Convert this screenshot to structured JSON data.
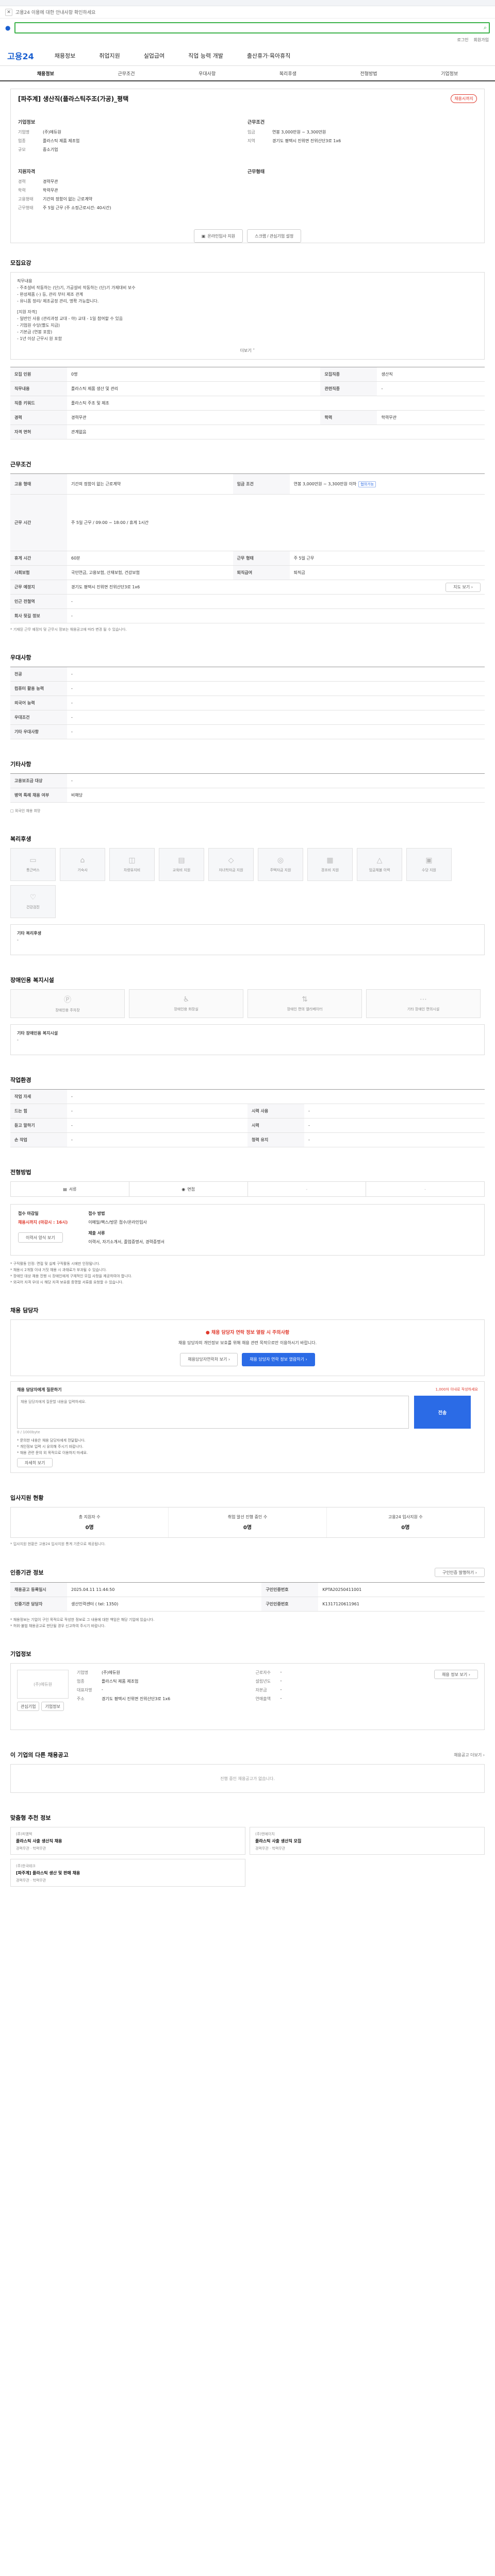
{
  "header": {
    "notice_text": "고용24 이용에 대한 안내사항 확인하세요",
    "util_links": [
      "로그인",
      "회원가입"
    ],
    "brand": "고용24",
    "nav": [
      "채용정보",
      "취업지원",
      "실업급여",
      "직업 능력 개발",
      "출산휴가·육아휴직"
    ]
  },
  "tabs": [
    "채용정보",
    "근무조건",
    "우대사항",
    "복리후생",
    "전형방법",
    "기업정보"
  ],
  "job": {
    "title": "[파주계] 생산직(플라스틱주조(가공)_평택",
    "badge": "채용시까지",
    "company_heading": "기업정보",
    "company_rows": [
      {
        "k": "기업명",
        "v": "(주)에듀원"
      },
      {
        "k": "업종",
        "v": "플라스틱 제품 제조업"
      },
      {
        "k": "규모",
        "v": "중소기업"
      }
    ],
    "condition_heading": "근무조건",
    "condition_rows": [
      {
        "k": "임금",
        "v": "연봉 3,000만원 ~ 3,300만원"
      },
      {
        "k": "지역",
        "v": "경기도 평택시 진위면 진위산단3로 1x6"
      }
    ],
    "req_heading": "지원자격",
    "req_rows": [
      {
        "k": "경력",
        "v": "경력무관"
      },
      {
        "k": "학력",
        "v": "학력무관"
      }
    ],
    "work_heading": "근무형태",
    "work_rows": [
      {
        "k": "고용형태",
        "v": "기간의 정함이 없는 근로계약"
      },
      {
        "k": "근무형태",
        "v": "주 5일 근무 (주 소정근로시간: 40시간)"
      }
    ],
    "apply_button": "온라인입사 지원",
    "scrap_button": "스크랩 / 관심기업 설정"
  },
  "recruit": {
    "heading": "모집요강",
    "desc_lines": [
      "직무내용",
      "- 주조설비 작동하는 (단)기, 가공설비 작동하는 (단)기 가제대비 보수",
      "- 완성제품 (-) 등, 관리 부터 제조 관계",
      "- 유니폼 정리/ 제조공정 관리, 명확 가능합니다.",
      "",
      "[지원 자격]",
      "- 일반인 사용 (관리과정 교대 - 야) 교대 - 1일 참여할 수 있음",
      "- 기업원 수당(별도 지급)",
      "- 기본급 (연봉 포함)",
      "- 1년 이상 근무시 원 포함"
    ],
    "more": "더보기 ˅",
    "rows": [
      {
        "h": "모집 인원",
        "v": "0명",
        "h2": "모집직종",
        "v2": "생산직"
      },
      {
        "h": "직무내용",
        "v": "플라스틱 제품 생산 및 관리",
        "h2": "관련직종",
        "v2": "-"
      },
      {
        "h": "직종 키워드",
        "v": "플라스틱 주조 및 제조",
        "h2": "",
        "v2": ""
      },
      {
        "h": "경력",
        "v": "경력무관",
        "h2": "학력",
        "v2": "학력무관"
      },
      {
        "h": "자격 면허",
        "v": "관계없음",
        "h2": "",
        "v2": ""
      }
    ]
  },
  "conditions": {
    "heading": "근무조건",
    "rows": [
      {
        "h": "고용 형태",
        "v": "기간의 정함이 없는 근로계약",
        "h2": "임금 조건",
        "v2": "연봉 3,000만원 ~ 3,300만원 이하"
      },
      {
        "h": "근무 시간",
        "v": "주 5일 근무 / 09:00 ~ 18:00 / 휴게 1시간",
        "h2": "",
        "v2": ""
      },
      {
        "h": "휴게 시간",
        "v": "60분",
        "h2": "근무 형태",
        "v2": "주 5일 근무"
      },
      {
        "h": "사회보험",
        "v": "국민연금, 고용보험, 산재보험, 건강보험",
        "h2": "퇴직급여",
        "v2": "퇴직금"
      },
      {
        "h": "근무 예정지",
        "v": "경기도 평택시 진위면 진위산단3로 1x6",
        "h2": "",
        "v2": ""
      },
      {
        "h": "인근 전철역",
        "v": "-",
        "h2": "",
        "v2": ""
      },
      {
        "h": "회사 뒷길 정보",
        "v": "-",
        "h2": "",
        "v2": ""
      }
    ],
    "pay_chip": "협의가능",
    "map_button": "지도 보기 ›",
    "note": "* 기재된 근무 예정지 및 근무시 정보는 채용공고에 따라 변경 될 수 있습니다."
  },
  "preference": {
    "heading": "우대사항",
    "rows": [
      {
        "h": "전공",
        "v": "-"
      },
      {
        "h": "컴퓨터 활용 능력",
        "v": "-"
      },
      {
        "h": "외국어 능력",
        "v": "-"
      },
      {
        "h": "우대조건",
        "v": "-"
      },
      {
        "h": "기타 우대사항",
        "v": "-"
      }
    ]
  },
  "etc": {
    "heading": "기타사항",
    "rows": [
      {
        "h": "고용보조금 대상",
        "v": "-"
      },
      {
        "h": "병역 특례 채용 여부",
        "v": "비해당"
      }
    ],
    "check_label": "□ 외국인 채용 희망"
  },
  "welfare": {
    "heading": "복리후생",
    "items": [
      "통근버스",
      "기숙사",
      "차량유지비",
      "교육비 지원",
      "자녀학자금 지원",
      "주택자금 지원",
      "경조비 지원",
      "임금체불 이력",
      "수당 지원",
      "건강검진"
    ],
    "extra_label": "기타 복리후생",
    "extra_value": "-"
  },
  "disability": {
    "heading": "장애인용 복지시설",
    "items": [
      "장애인용 주차장",
      "장애인용 화장실",
      "장애인 편의 엘리베이터",
      "기타 장애인 편의시설"
    ],
    "extra_label": "기타 장애인용 복지시설",
    "extra_value": "-"
  },
  "env": {
    "heading": "작업환경",
    "rows": [
      {
        "h": "작업 자세",
        "v": "-",
        "h2": "",
        "v2": ""
      },
      {
        "h": "드는 힘",
        "v": "-",
        "h2": "시력 사용",
        "v2": "-"
      },
      {
        "h": "듣고 말하기",
        "v": "-",
        "h2": "시력",
        "v2": "-"
      },
      {
        "h": "손 작업",
        "v": "-",
        "h2": "청력 유지",
        "v2": "-"
      }
    ]
  },
  "process": {
    "heading": "전형방법",
    "steps": [
      "서류",
      "면접",
      "-",
      "-"
    ]
  },
  "apply": {
    "period_label": "접수 마감일",
    "period_value": "채용시까지 (마감시 : 16시)",
    "method_label": "접수 방법",
    "method_value": "이메일/팩스/방문 접수/온라인입사",
    "doc_label": "제출 서류",
    "doc_value": "이력서, 자기소개서, 졸업증명서, 경력증명서",
    "doc_button": "이력서 양식 보기",
    "notes": [
      "* 구직활동 인정: 면접 및 실제 구직활동 시에만 인정됩니다.",
      "* 채용시 2개월 이내 거짓 채용 시 과태료가 부과될 수 있습니다.",
      "* 장애인 대상 채용 진행 시 장애인에게 구체적인 모집 사항을 제공하여야 합니다.",
      "* 외국어 자격 우대 시 해당 자격 보유를 증명할 서류를 요청할 수 있습니다."
    ]
  },
  "contact": {
    "heading": "채용 담당자",
    "alert_title": "채용 담당자 연락 정보 열람 시 주의사항",
    "alert_body": "채용 담당자의 개인정보 보호를 위해 채용 관련 목적으로만 이용하시기 바랍니다.",
    "btn_apply": "채용담당자연락처 보기 ›",
    "btn_req": "채용 담당자 연락 정보 열람하기 ›",
    "qna_label": "채용 담당자에게 질문하기",
    "qna_hint": "1,000자 이내로 작성하세요",
    "qna_placeholder": "채용 담당자에게 질문할 내용을 입력하세요.",
    "qna_count": "0 / 1000byte",
    "qna_submit": "전송",
    "qna_notes": [
      "* 문의한 내용은 채용 담당자에게 전달됩니다.",
      "* 개인정보 입력 시 유의해 주시기 바랍니다.",
      "* 채용 관련 문의 외 목적으로 이용하지 마세요."
    ],
    "qna_more": "자세히 보기"
  },
  "stats": {
    "heading": "입사지원 현황",
    "items": [
      {
        "label": "총 지원자 수",
        "value": "0명"
      },
      {
        "label": "취업 알선 진행 중인 수",
        "value": "0명"
      },
      {
        "label": "고용24 입사지원 수",
        "value": "0명"
      }
    ],
    "note": "* 입사지원 현황은 고용24 입사지원 통계 기준으로 제공됩니다."
  },
  "info": {
    "heading": "인증기관 정보",
    "print_button": "구인인증 발행하기 ›",
    "rows": [
      {
        "h": "채용공고 등록일시",
        "v": "2025.04.11 11:44:50",
        "h2": "구인인증번호",
        "v2": "KPTA20250411001"
      },
      {
        "h": "인증기관 담당자",
        "v": "생산인력센터 ( tel: 1350)",
        "h2": "구인인증번호",
        "v2": "K1317120611961"
      }
    ],
    "notes": [
      "* 채용정보는 기업이 구인 목적으로 작성한 정보로 그 내용에 대한 책임은 해당 기업에 있습니다.",
      "* 허위·불법 채용공고로 판단될 경우 신고하여 주시기 바랍니다."
    ]
  },
  "company": {
    "heading": "기업정보",
    "logo_text": "(주)에듀원",
    "btn_follow": "관심기업",
    "btn_more": "기업정보",
    "rows": [
      {
        "k": "기업명",
        "v": "(주)에듀원"
      },
      {
        "k": "업종",
        "v": "플라스틱 제품 제조업"
      },
      {
        "k": "대표자명",
        "v": "-"
      },
      {
        "k": "주소",
        "v": "경기도 평택시 진위면 진위산단3로 1x6"
      }
    ],
    "rows2": [
      {
        "k": "근로자수",
        "v": "-"
      },
      {
        "k": "설립년도",
        "v": "-"
      },
      {
        "k": "자본금",
        "v": "-"
      },
      {
        "k": "연매출액",
        "v": "-"
      }
    ],
    "info_button": "채용 정보 보기 ›"
  },
  "other_jobs": {
    "heading": "이 기업의 다른 채용공고",
    "empty": "진행 중인 채용공고가 없습니다.",
    "more": "채용공고 더보기 ›"
  },
  "recommend": {
    "heading": "맞춤형 추천 정보",
    "cards": [
      {
        "co": "(주)피엠텍",
        "title": "플라스틱 사출 생산직 채용",
        "meta": "경력무관 · 학력무관"
      },
      {
        "co": "(주)엔에이치",
        "title": "플라스틱 사출 생산직 모집",
        "meta": "경력무관 · 학력무관"
      },
      {
        "co": "(주)한국테크",
        "title": "[파주계] 플라스틱 생산 및 판매 채용",
        "meta": "경력무관 · 학력무관"
      }
    ]
  }
}
